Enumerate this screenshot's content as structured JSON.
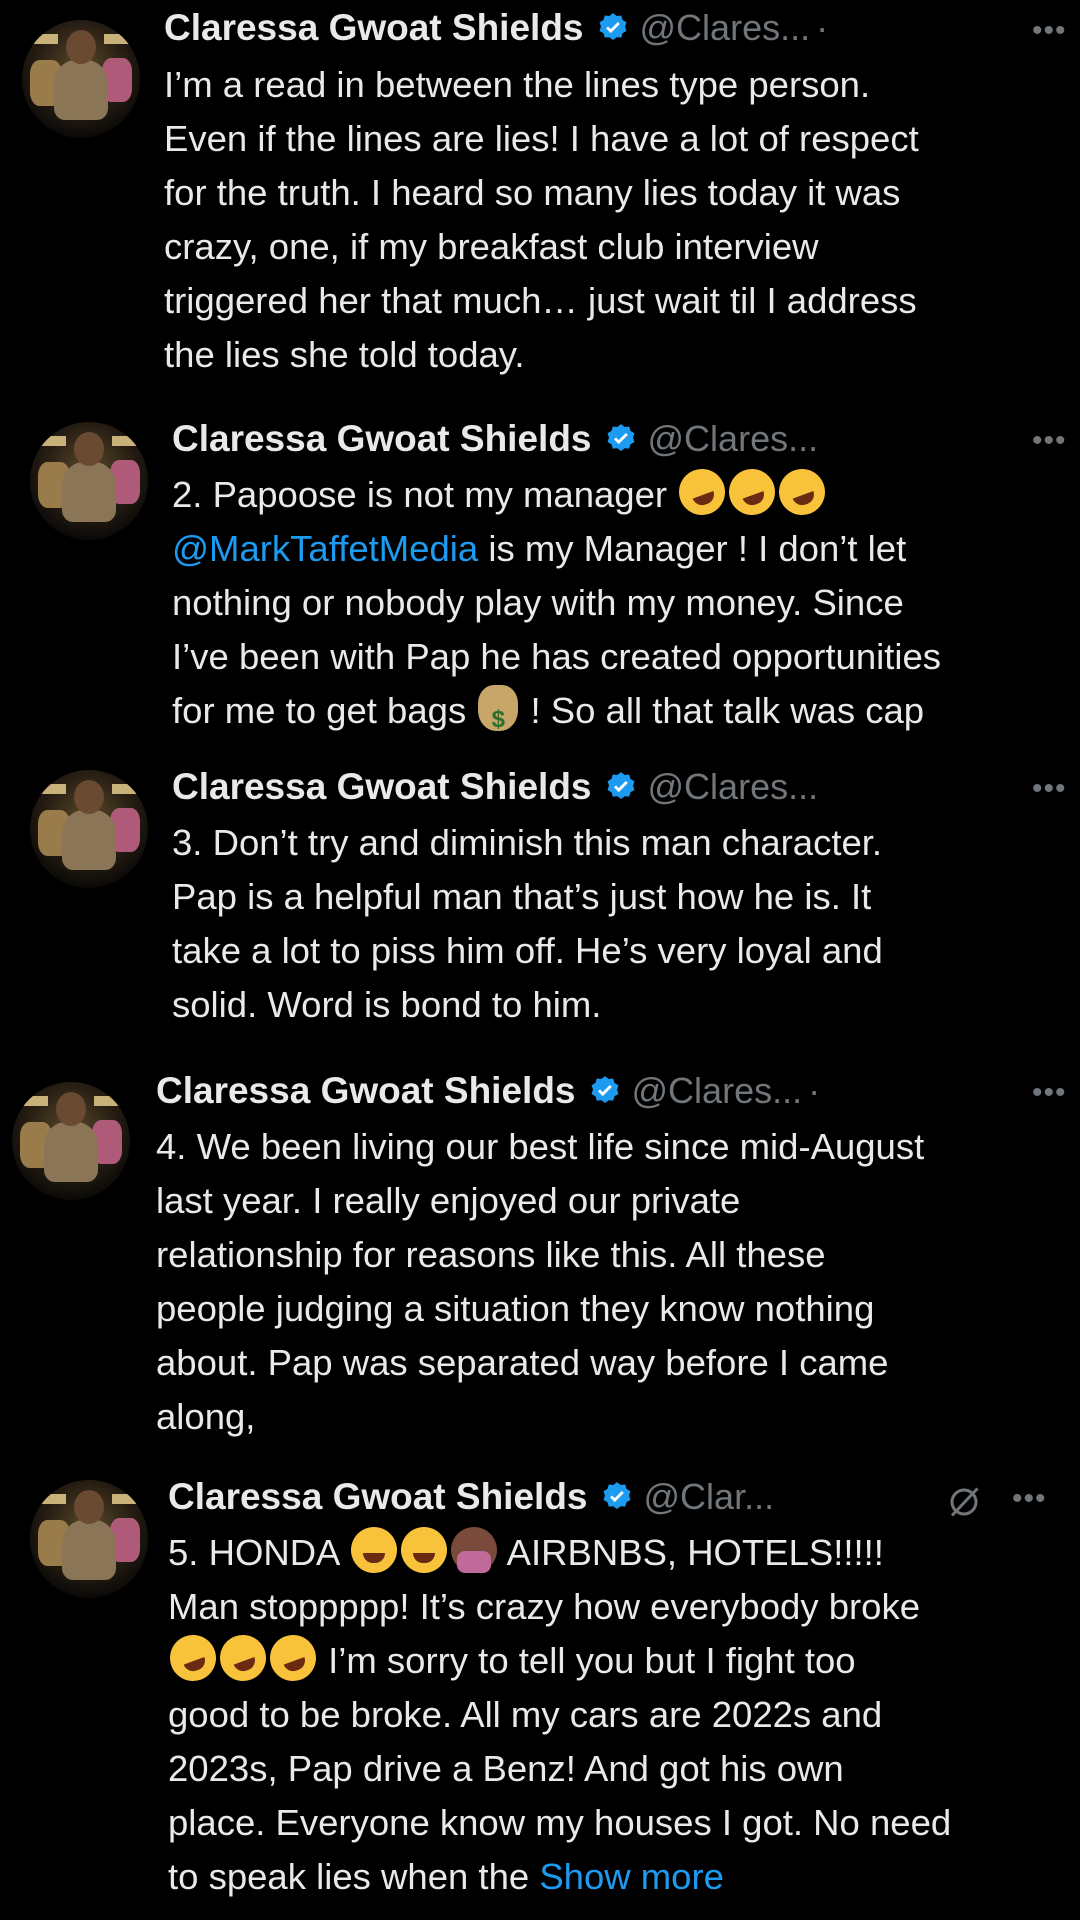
{
  "colors": {
    "background": "#000000",
    "text": "#e7e9ea",
    "secondary": "#71767b",
    "link": "#1d9bf0",
    "verified": "#1d9bf0"
  },
  "tweets": [
    {
      "name": "Claressa Gwoat Shields",
      "handle": "@Clares...",
      "dot": "·",
      "lines": [
        "I’m a read in between the lines type person.",
        "Even if the lines are lies! I have a lot of respect",
        "for the truth. I heard so many lies today it was",
        "crazy, one,  if my breakfast club interview",
        "triggered her that much… just wait til I address",
        "the lies she told today."
      ]
    },
    {
      "name": "Claressa Gwoat Shields",
      "handle": "@Clares...",
      "line1": "2. Papoose is not my manager",
      "mention": "@MarkTaffetMedia",
      "line2_rest": " is my Manager ! I don’t let",
      "line3": "nothing or nobody play with my money. Since",
      "line4": "I’ve been with Pap he has created opportunities",
      "line5a": "for me to get bags",
      "line5b": " ! So all that talk was cap"
    },
    {
      "name": "Claressa Gwoat Shields",
      "handle": "@Clares...",
      "lines": [
        "3. Don’t try and diminish this man character.",
        "Pap is a helpful man that’s just how he is. It",
        "take a lot to piss him off. He’s very loyal and",
        "solid. Word is bond to him."
      ]
    },
    {
      "name": "Claressa Gwoat Shields",
      "handle": "@Clares...",
      "dot": "·",
      "lines": [
        "4. We been living our best life since mid-August",
        "last year. I really enjoyed our private",
        "relationship for reasons like this. All these",
        "people judging a situation they know nothing",
        "about. Pap was separated way before I came",
        "along,"
      ]
    },
    {
      "name": "Claressa Gwoat Shields",
      "handle": "@Clar...",
      "line1a": "5. HONDA",
      "line1b": " AIRBNBS, HOTELS!!!!!",
      "line2": "Man stoppppp! It’s crazy how everybody broke",
      "line3b": " I’m sorry to tell you but I fight too",
      "line4": "good to be broke. All my cars are 2022s and",
      "line5": "2023s, Pap drive a Benz! And got his own",
      "line6": "place. Everyone know my houses I got. No need",
      "line7": "to speak lies when the ",
      "show_more": "Show more"
    }
  ],
  "icons": {
    "more": "more-icon",
    "verified": "verified-badge-icon",
    "grok": "grok-icon"
  },
  "more_glyph": "•••"
}
